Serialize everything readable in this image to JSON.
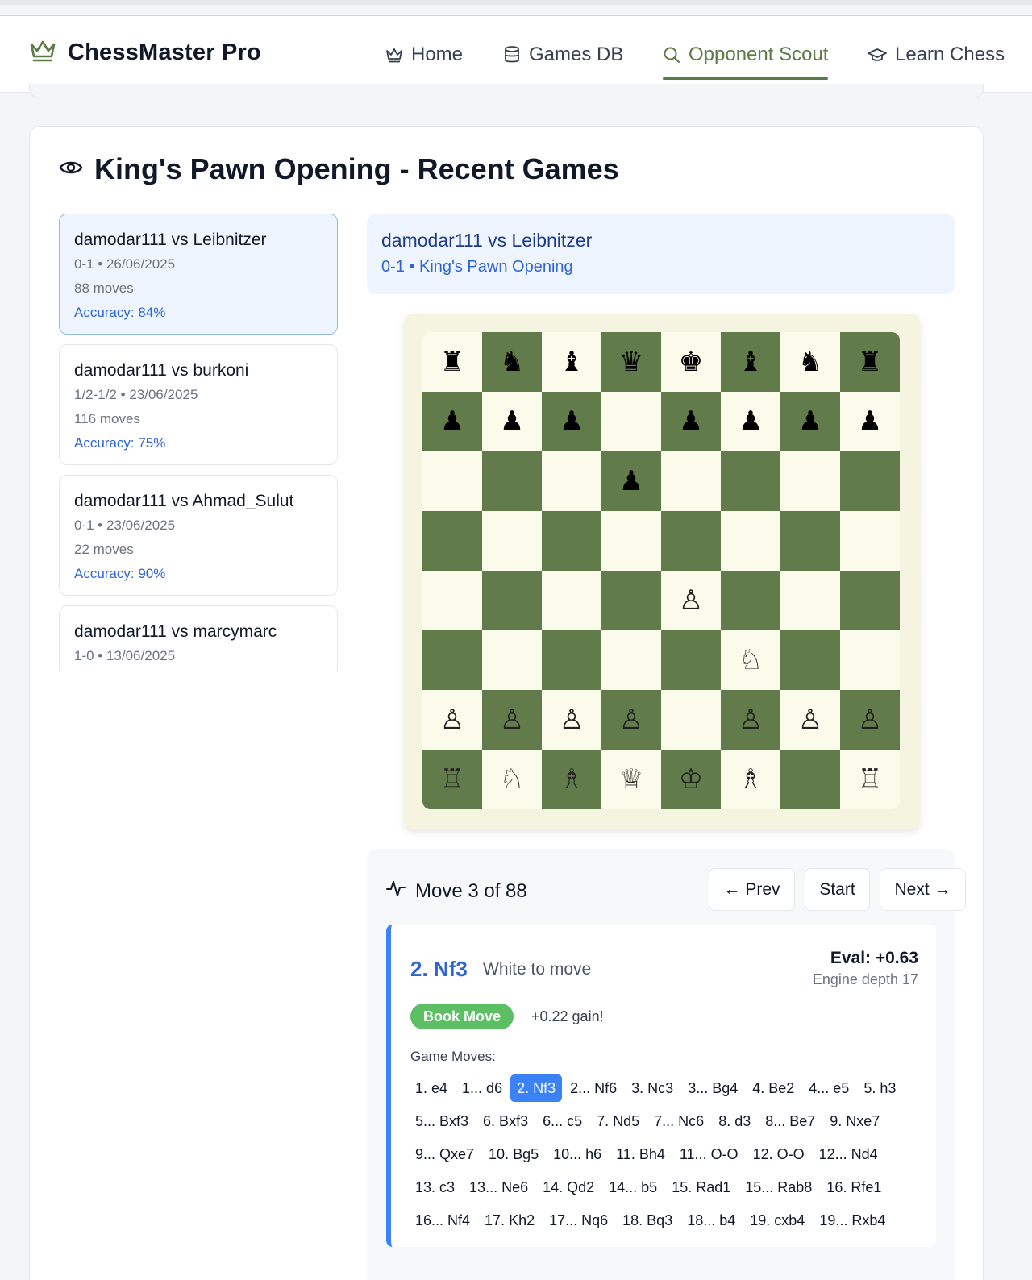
{
  "app": {
    "title": "ChessMaster Pro"
  },
  "nav": {
    "home": "Home",
    "games_db": "Games DB",
    "opponent_scout": "Opponent Scout",
    "learn_chess": "Learn Chess",
    "active": "Opponent Scout"
  },
  "section": {
    "title": "King's Pawn Opening - Recent Games"
  },
  "games": [
    {
      "title": "damodar111 vs Leibnitzer",
      "meta": "0-1 • 26/06/2025",
      "moves": "88 moves",
      "accuracy": "Accuracy: 84%",
      "selected": true
    },
    {
      "title": "damodar111 vs burkoni",
      "meta": "1/2-1/2 • 23/06/2025",
      "moves": "116 moves",
      "accuracy": "Accuracy: 75%"
    },
    {
      "title": "damodar111 vs Ahmad_Sulut",
      "meta": "0-1 • 23/06/2025",
      "moves": "22 moves",
      "accuracy": "Accuracy: 90%"
    },
    {
      "title": "damodar111 vs marcymarc",
      "meta": "1-0 • 13/06/2025",
      "moves": "",
      "accuracy": ""
    }
  ],
  "selected_game": {
    "title": "damodar111 vs Leibnitzer",
    "subtitle": "0-1 • King's Pawn Opening"
  },
  "board": {
    "colors": {
      "light": "#fafbea",
      "dark": "#627b4a"
    },
    "ranks": [
      [
        "♜",
        "♞",
        "♝",
        "♛",
        "♚",
        "♝",
        "♞",
        "♜"
      ],
      [
        "♟",
        "♟",
        "♟",
        "",
        "♟",
        "♟",
        "♟",
        "♟"
      ],
      [
        "",
        "",
        "",
        "♟",
        "",
        "",
        "",
        ""
      ],
      [
        "",
        "",
        "",
        "",
        "",
        "",
        "",
        ""
      ],
      [
        "",
        "",
        "",
        "",
        "♙",
        "",
        "",
        ""
      ],
      [
        "",
        "",
        "",
        "",
        "",
        "♘",
        "",
        ""
      ],
      [
        "♙",
        "♙",
        "♙",
        "♙",
        "",
        "♙",
        "♙",
        "♙"
      ],
      [
        "♖",
        "♘",
        "♗",
        "♕",
        "♔",
        "♗",
        "",
        "♖"
      ]
    ]
  },
  "move_panel": {
    "counter": "Move 3 of 88",
    "prev_label": "← Prev",
    "start_label": "Start",
    "next_label": "Next →",
    "current_move": "2. Nf3",
    "turn": "White to move",
    "eval": "Eval: +0.63",
    "depth": "Engine depth 17",
    "badge": "Book Move",
    "gain": "+0.22 gain!",
    "moves_label": "Game Moves:",
    "current_index": 2,
    "moves": [
      "1. e4",
      "1... d6",
      "2. Nf3",
      "2... Nf6",
      "3. Nc3",
      "3... Bg4",
      "4. Be2",
      "4... e5",
      "5. h3",
      "5... Bxf3",
      "6. Bxf3",
      "6... c5",
      "7. Nd5",
      "7... Nc6",
      "8. d3",
      "8... Be7",
      "9. Nxe7",
      "9... Qxe7",
      "10. Bg5",
      "10... h6",
      "11. Bh4",
      "11... O-O",
      "12. O-O",
      "12... Nd4",
      "13. c3",
      "13... Ne6",
      "14. Qd2",
      "14... b5",
      "15. Rad1",
      "15... Rab8",
      "16. Rfe1",
      "16... Nf4",
      "17. Kh2",
      "17... Nq6",
      "18. Bq3",
      "18... b4",
      "19. cxb4",
      "19... Rxb4"
    ]
  }
}
